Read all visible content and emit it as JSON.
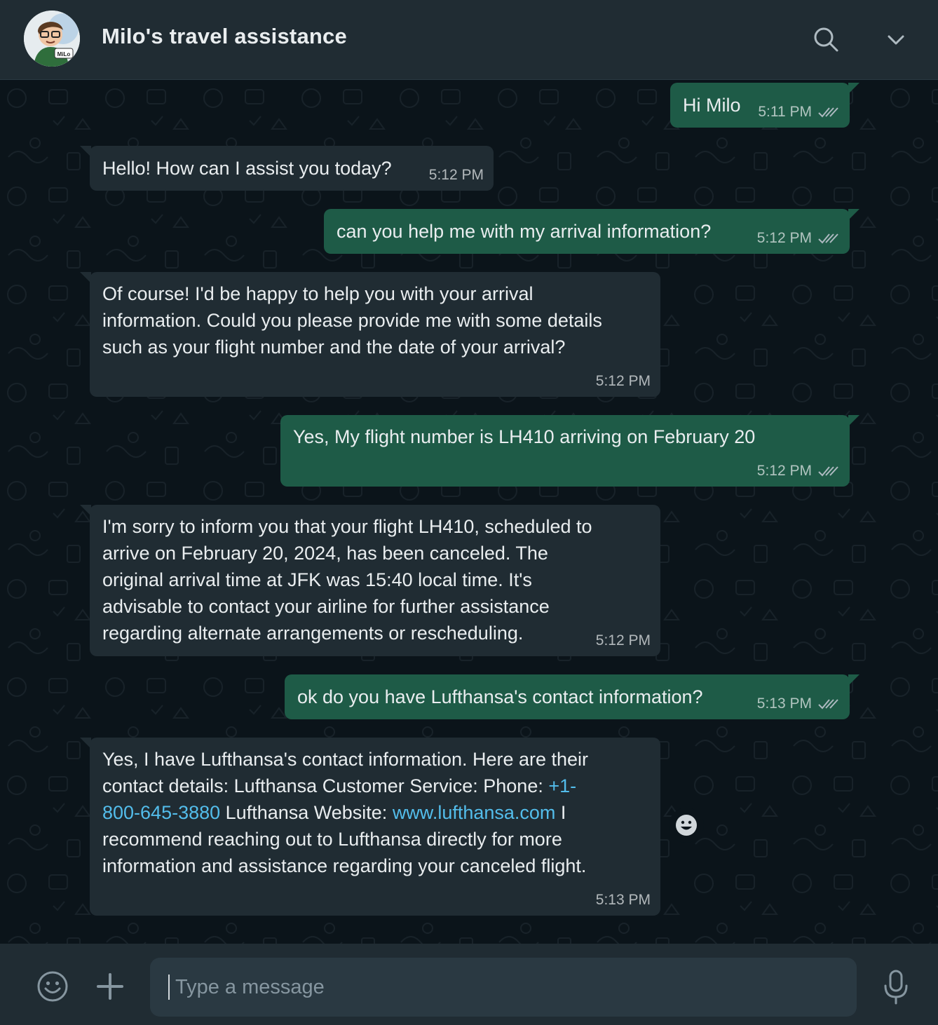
{
  "header": {
    "title": "Milo's travel assistance",
    "avatar_label": "MiLo"
  },
  "messages": [
    {
      "direction": "out",
      "text": "Hi Milo",
      "time": "5:11 PM",
      "status": "read"
    },
    {
      "direction": "in",
      "text": "Hello! How can I assist you today?",
      "time": "5:12 PM"
    },
    {
      "direction": "out",
      "text": "can you help me with my arrival information?",
      "time": "5:12 PM",
      "status": "read"
    },
    {
      "direction": "in",
      "lines": [
        "Of course! I'd be happy to help you with your arrival",
        "information. Could you please provide me with some details",
        "such as your flight number and the date of your arrival?"
      ],
      "time": "5:12 PM"
    },
    {
      "direction": "out",
      "text": "Yes, My flight number is LH410 arriving on February 20",
      "time": "5:12 PM",
      "status": "read"
    },
    {
      "direction": "in",
      "lines": [
        "I'm sorry to inform you that your flight LH410, scheduled to",
        "arrive on February 20, 2024, has been canceled. The",
        "original arrival time at JFK was 15:40 local time. It's",
        "advisable to contact your airline for further assistance",
        "regarding alternate arrangements or rescheduling."
      ],
      "time": "5:12 PM"
    },
    {
      "direction": "out",
      "text": "ok do you have Lufthansa's contact information?",
      "time": "5:13 PM",
      "status": "read"
    },
    {
      "direction": "in",
      "time": "5:13 PM",
      "line1": "Yes, I have Lufthansa's contact information. Here are their",
      "line2_pre": "contact details: Lufthansa Customer Service: Phone: ",
      "phone_part1": "+1-",
      "phone_part2": "800-645-3880",
      "line3_mid": " Lufthansa Website: ",
      "website": "www.lufthansa.com",
      "line3_post": " I",
      "line4": "recommend reaching out to Lufthansa directly for more",
      "line5": "information and assistance regarding your canceled flight."
    }
  ],
  "composer": {
    "placeholder": "Type a message"
  },
  "icons": {
    "search": "search-icon",
    "menu": "chevron-down-icon",
    "emoji": "emoji-icon",
    "attach": "plus-icon",
    "mic": "microphone-icon",
    "react": "smiley-react-icon",
    "ticks": "double-check-icon"
  },
  "colors": {
    "header_bg": "#202c33",
    "chat_bg": "#0b141a",
    "incoming_bubble": "#202c33",
    "outgoing_bubble": "#1e5b47",
    "link": "#53bdeb",
    "read_ticks": "#aebac1"
  }
}
